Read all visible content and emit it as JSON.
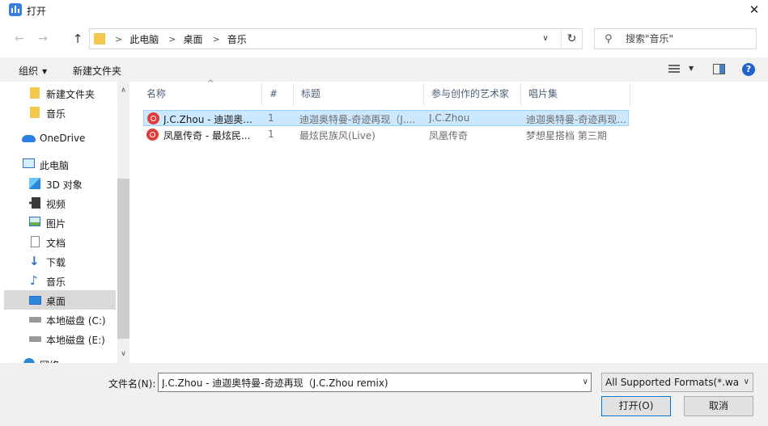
{
  "window": {
    "title": "打开",
    "close_glyph": "✕"
  },
  "nav": {
    "back_glyph": "←",
    "forward_glyph": "→",
    "up_glyph": "↑"
  },
  "address": {
    "crumbs": [
      "此电脑",
      "桌面",
      "音乐"
    ],
    "sep_glyph": ">",
    "dropdown_glyph": "∨",
    "refresh_glyph": "↻"
  },
  "search": {
    "placeholder": "搜索\"音乐\"",
    "icon_glyph": "⚲"
  },
  "toolbar": {
    "organize_label": "组织",
    "caret_glyph": "▼",
    "new_folder_label": "新建文件夹",
    "help_glyph": "?"
  },
  "sidebar": {
    "items": [
      {
        "label": "新建文件夹",
        "icon": "folder-icon"
      },
      {
        "label": "音乐",
        "icon": "folder-icon"
      },
      {
        "label": "OneDrive",
        "icon": "cloud-icon"
      },
      {
        "label": "此电脑",
        "icon": "computer-icon"
      },
      {
        "label": "3D 对象",
        "icon": "3d-objects-icon"
      },
      {
        "label": "视频",
        "icon": "video-icon"
      },
      {
        "label": "图片",
        "icon": "pictures-icon"
      },
      {
        "label": "文档",
        "icon": "documents-icon"
      },
      {
        "label": "下载",
        "icon": "download-icon",
        "glyph": "↓"
      },
      {
        "label": "音乐",
        "icon": "music-icon",
        "glyph": "♪"
      },
      {
        "label": "桌面",
        "icon": "desktop-icon",
        "selected": true
      },
      {
        "label": "本地磁盘 (C:)",
        "icon": "drive-icon"
      },
      {
        "label": "本地磁盘 (E:)",
        "icon": "drive-icon"
      },
      {
        "label": "网络",
        "icon": "network-icon"
      }
    ],
    "scroll_up_glyph": "∧",
    "scroll_down_glyph": "∨"
  },
  "filelist": {
    "sort_glyph": "^",
    "columns": [
      "名称",
      "#",
      "标题",
      "参与创作的艺术家",
      "唱片集"
    ],
    "rows": [
      {
        "name": "J.C.Zhou - 迪迦奥...",
        "track": "1",
        "title": "迪迦奥特曼-奇迹再现（J....",
        "artist": "J.C.Zhou",
        "album": "迪迦奥特曼-奇迹再现...",
        "selected": true
      },
      {
        "name": "凤凰传奇 - 最炫民...",
        "track": "1",
        "title": "最炫民族风(Live)",
        "artist": "凤凰传奇",
        "album": "梦想星搭档 第三期",
        "selected": false
      }
    ]
  },
  "footer": {
    "filename_label": "文件名(N):",
    "filename_value": "J.C.Zhou - 迪迦奥特曼-奇迹再现（J.C.Zhou remix)",
    "filetype_value": "All Supported Formats(*.wav",
    "dropdown_glyph": "∨",
    "open_label": "打开(O)",
    "cancel_label": "取消"
  }
}
